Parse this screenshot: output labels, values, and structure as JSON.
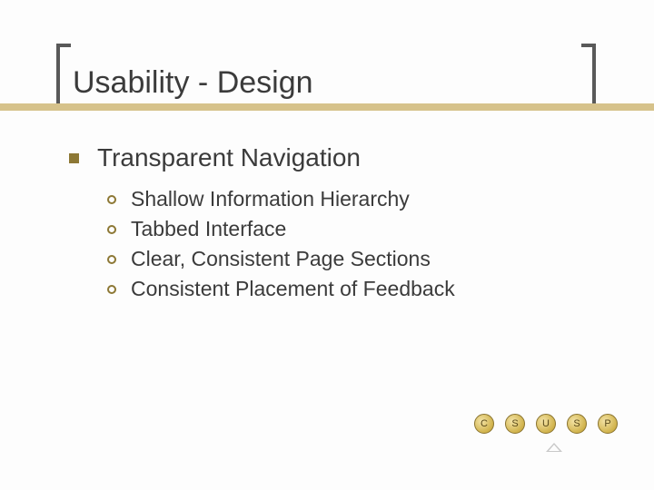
{
  "title": "Usability - Design",
  "main_bullet": "Transparent Navigation",
  "sub_bullets": [
    "Shallow Information Hierarchy",
    "Tabbed Interface",
    "Clear, Consistent Page Sections",
    "Consistent Placement of Feedback"
  ],
  "footer_labels": [
    "C",
    "S",
    "U",
    "S",
    "P"
  ]
}
